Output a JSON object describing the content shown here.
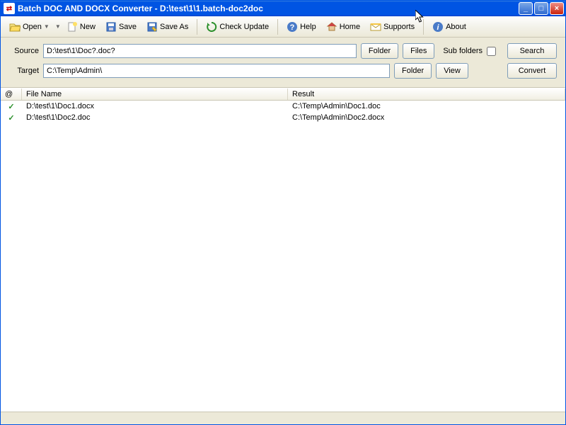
{
  "title": "Batch DOC AND DOCX Converter - D:\\test\\1\\1.batch-doc2doc",
  "toolbar": {
    "open": "Open",
    "new": "New",
    "save": "Save",
    "saveas": "Save As",
    "check": "Check Update",
    "help": "Help",
    "home": "Home",
    "supports": "Supports",
    "about": "About"
  },
  "form": {
    "source_label": "Source",
    "source_value": "D:\\test\\1\\Doc?.doc?",
    "target_label": "Target",
    "target_value": "C:\\Temp\\Admin\\",
    "folder": "Folder",
    "files": "Files",
    "view": "View",
    "subfolders": "Sub folders",
    "search": "Search",
    "convert": "Convert"
  },
  "columns": {
    "status": "@",
    "file": "File Name",
    "result": "Result"
  },
  "rows": [
    {
      "file": "D:\\test\\1\\Doc1.docx",
      "result": "C:\\Temp\\Admin\\Doc1.doc"
    },
    {
      "file": "D:\\test\\1\\Doc2.doc",
      "result": "C:\\Temp\\Admin\\Doc2.docx"
    }
  ]
}
